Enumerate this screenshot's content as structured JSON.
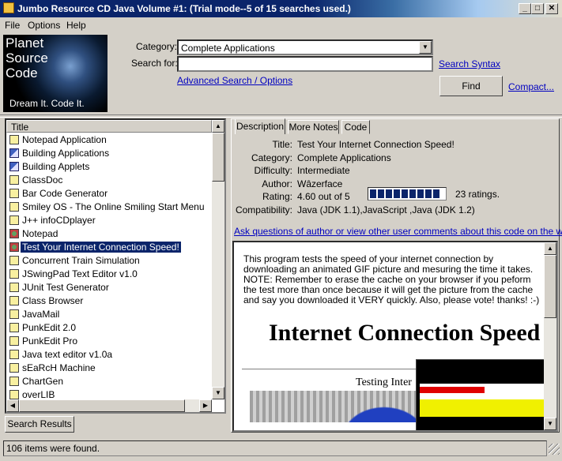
{
  "window": {
    "title": "Jumbo Resource CD Java Volume #1: (Trial mode--5 of 15 searches used.)",
    "controls": {
      "minimize": "_",
      "maximize": "□",
      "close": "✕"
    }
  },
  "menubar": {
    "items": [
      "File",
      "Options",
      "Help"
    ]
  },
  "logo": {
    "line1": "Planet",
    "line2": "Source",
    "line3": "Code",
    "tagline": "Dream It.  Code It."
  },
  "search": {
    "category_label": "Category:",
    "category_value": "Complete Applications",
    "searchfor_label": "Search for:",
    "searchfor_value": "",
    "syntax_link": "Search Syntax",
    "advanced_link": "Advanced Search / Options",
    "find_button": "Find",
    "compact_link": "Compact..."
  },
  "list": {
    "header": "Title",
    "items": [
      {
        "title": "Notepad Application",
        "icon": "scroll-icon"
      },
      {
        "title": "Building Applications",
        "icon": "book-icon"
      },
      {
        "title": "Building Applets",
        "icon": "book-icon"
      },
      {
        "title": "ClassDoc",
        "icon": "scroll-icon"
      },
      {
        "title": "Bar Code Generator",
        "icon": "scroll-icon"
      },
      {
        "title": "Smiley OS - The Online Smiling Start Menu",
        "icon": "scroll-icon"
      },
      {
        "title": "J++ infoCDplayer",
        "icon": "scroll-icon"
      },
      {
        "title": "Notepad",
        "icon": "gear-icon"
      },
      {
        "title": "Test Your Internet Connection Speed!",
        "icon": "gear-icon",
        "selected": true
      },
      {
        "title": "Concurrent Train Simulation",
        "icon": "scroll-icon"
      },
      {
        "title": "JSwingPad Text Editor v1.0",
        "icon": "scroll-icon"
      },
      {
        "title": "JUnit Test Generator",
        "icon": "scroll-icon"
      },
      {
        "title": "Class Browser",
        "icon": "scroll-icon"
      },
      {
        "title": "JavaMail",
        "icon": "scroll-icon"
      },
      {
        "title": "PunkEdit 2.0",
        "icon": "scroll-icon"
      },
      {
        "title": "PunkEdit Pro",
        "icon": "scroll-icon"
      },
      {
        "title": "Java text editor v1.0a",
        "icon": "scroll-icon"
      },
      {
        "title": "sEaRcH Machine",
        "icon": "scroll-icon"
      },
      {
        "title": "ChartGen",
        "icon": "scroll-icon"
      },
      {
        "title": "overLIB",
        "icon": "scroll-icon"
      }
    ]
  },
  "left_tab": "Search Results",
  "detail": {
    "tabs": [
      "Description",
      "More Notes",
      "Code"
    ],
    "fields": [
      {
        "label": "Title:",
        "value": "Test Your Internet Connection Speed!"
      },
      {
        "label": "Category:",
        "value": "Complete Applications"
      },
      {
        "label": "Difficulty:",
        "value": "Intermediate"
      },
      {
        "label": "Author:",
        "value": "Wâzerface"
      },
      {
        "label": "Rating:",
        "value": "4.60 out of 5"
      },
      {
        "label": "Compatibility:",
        "value": "Java (JDK 1.1),JavaScript ,Java (JDK 1.2)"
      }
    ],
    "rating_fraction": 0.92,
    "rating_count": "23 ratings.",
    "ask_link": "Ask questions of author or view other user comments about this code on the web...",
    "description": "This program tests the speed of your internet connection by downloading an animated GIF picture and mesuring the time it takes. NOTE: Remember to erase the cache on your browser if you peform the test more than once because it will get the picture from the cache and say you downloaded it VERY quickly. Also, please vote! thanks! :-)",
    "preview_heading": "Internet Connection Speed",
    "preview_sub": "Testing Inter"
  },
  "status": "106 items were found."
}
